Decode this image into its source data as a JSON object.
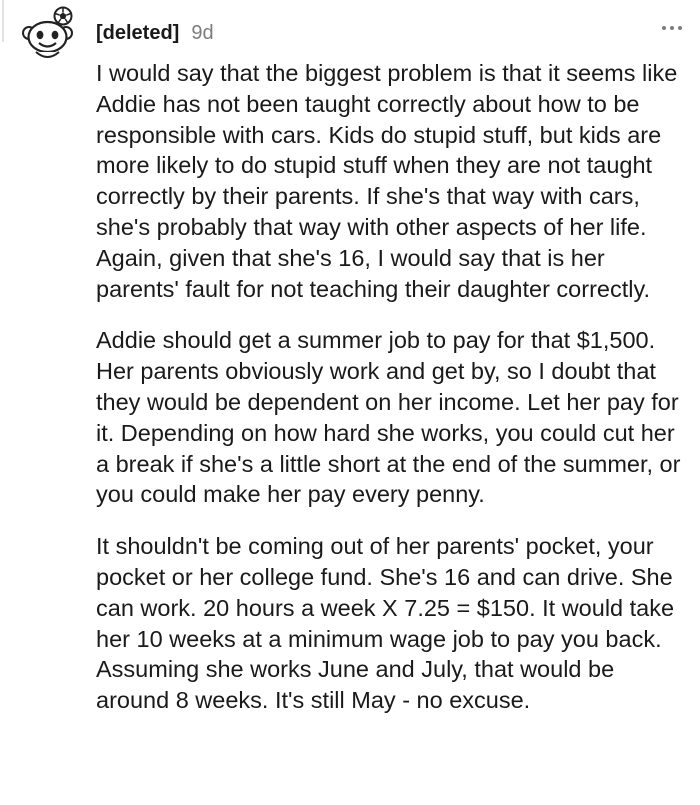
{
  "comment": {
    "author": "[deleted]",
    "age": "9d",
    "avatar_icon": "snoo-avatar-icon",
    "more_icon": "more-options-icon",
    "paragraphs": [
      "I would say that the biggest problem is that it seems like Addie has not been taught correctly about how to be responsible with cars. Kids do stupid stuff, but kids are more likely to do stupid stuff when they are not taught correctly by their parents. If she's that way with cars, she's probably that way with other aspects of her life. Again, given that she's 16, I would say that is her parents' fault for not teaching their daughter correctly.",
      "Addie should get a summer job to pay for that $1,500. Her parents obviously work and get by, so I doubt that they would be dependent on her income. Let her pay for it. Depending on how hard she works, you could cut her a break if she's a little short at the end of the summer, or you could make her pay every penny.",
      "It shouldn't be coming out of her parents' pocket, your pocket or her college fund. She's 16 and can drive. She can work. 20 hours a week X 7.25 = $150. It would take her 10 weeks at a minimum wage job to pay you back. Assuming she works June and July, that would be around 8 weeks. It's still May - no excuse."
    ]
  },
  "colors": {
    "text": "#1a1a1b",
    "meta": "#7c7c7c",
    "thread_line": "#e2e2e2"
  }
}
